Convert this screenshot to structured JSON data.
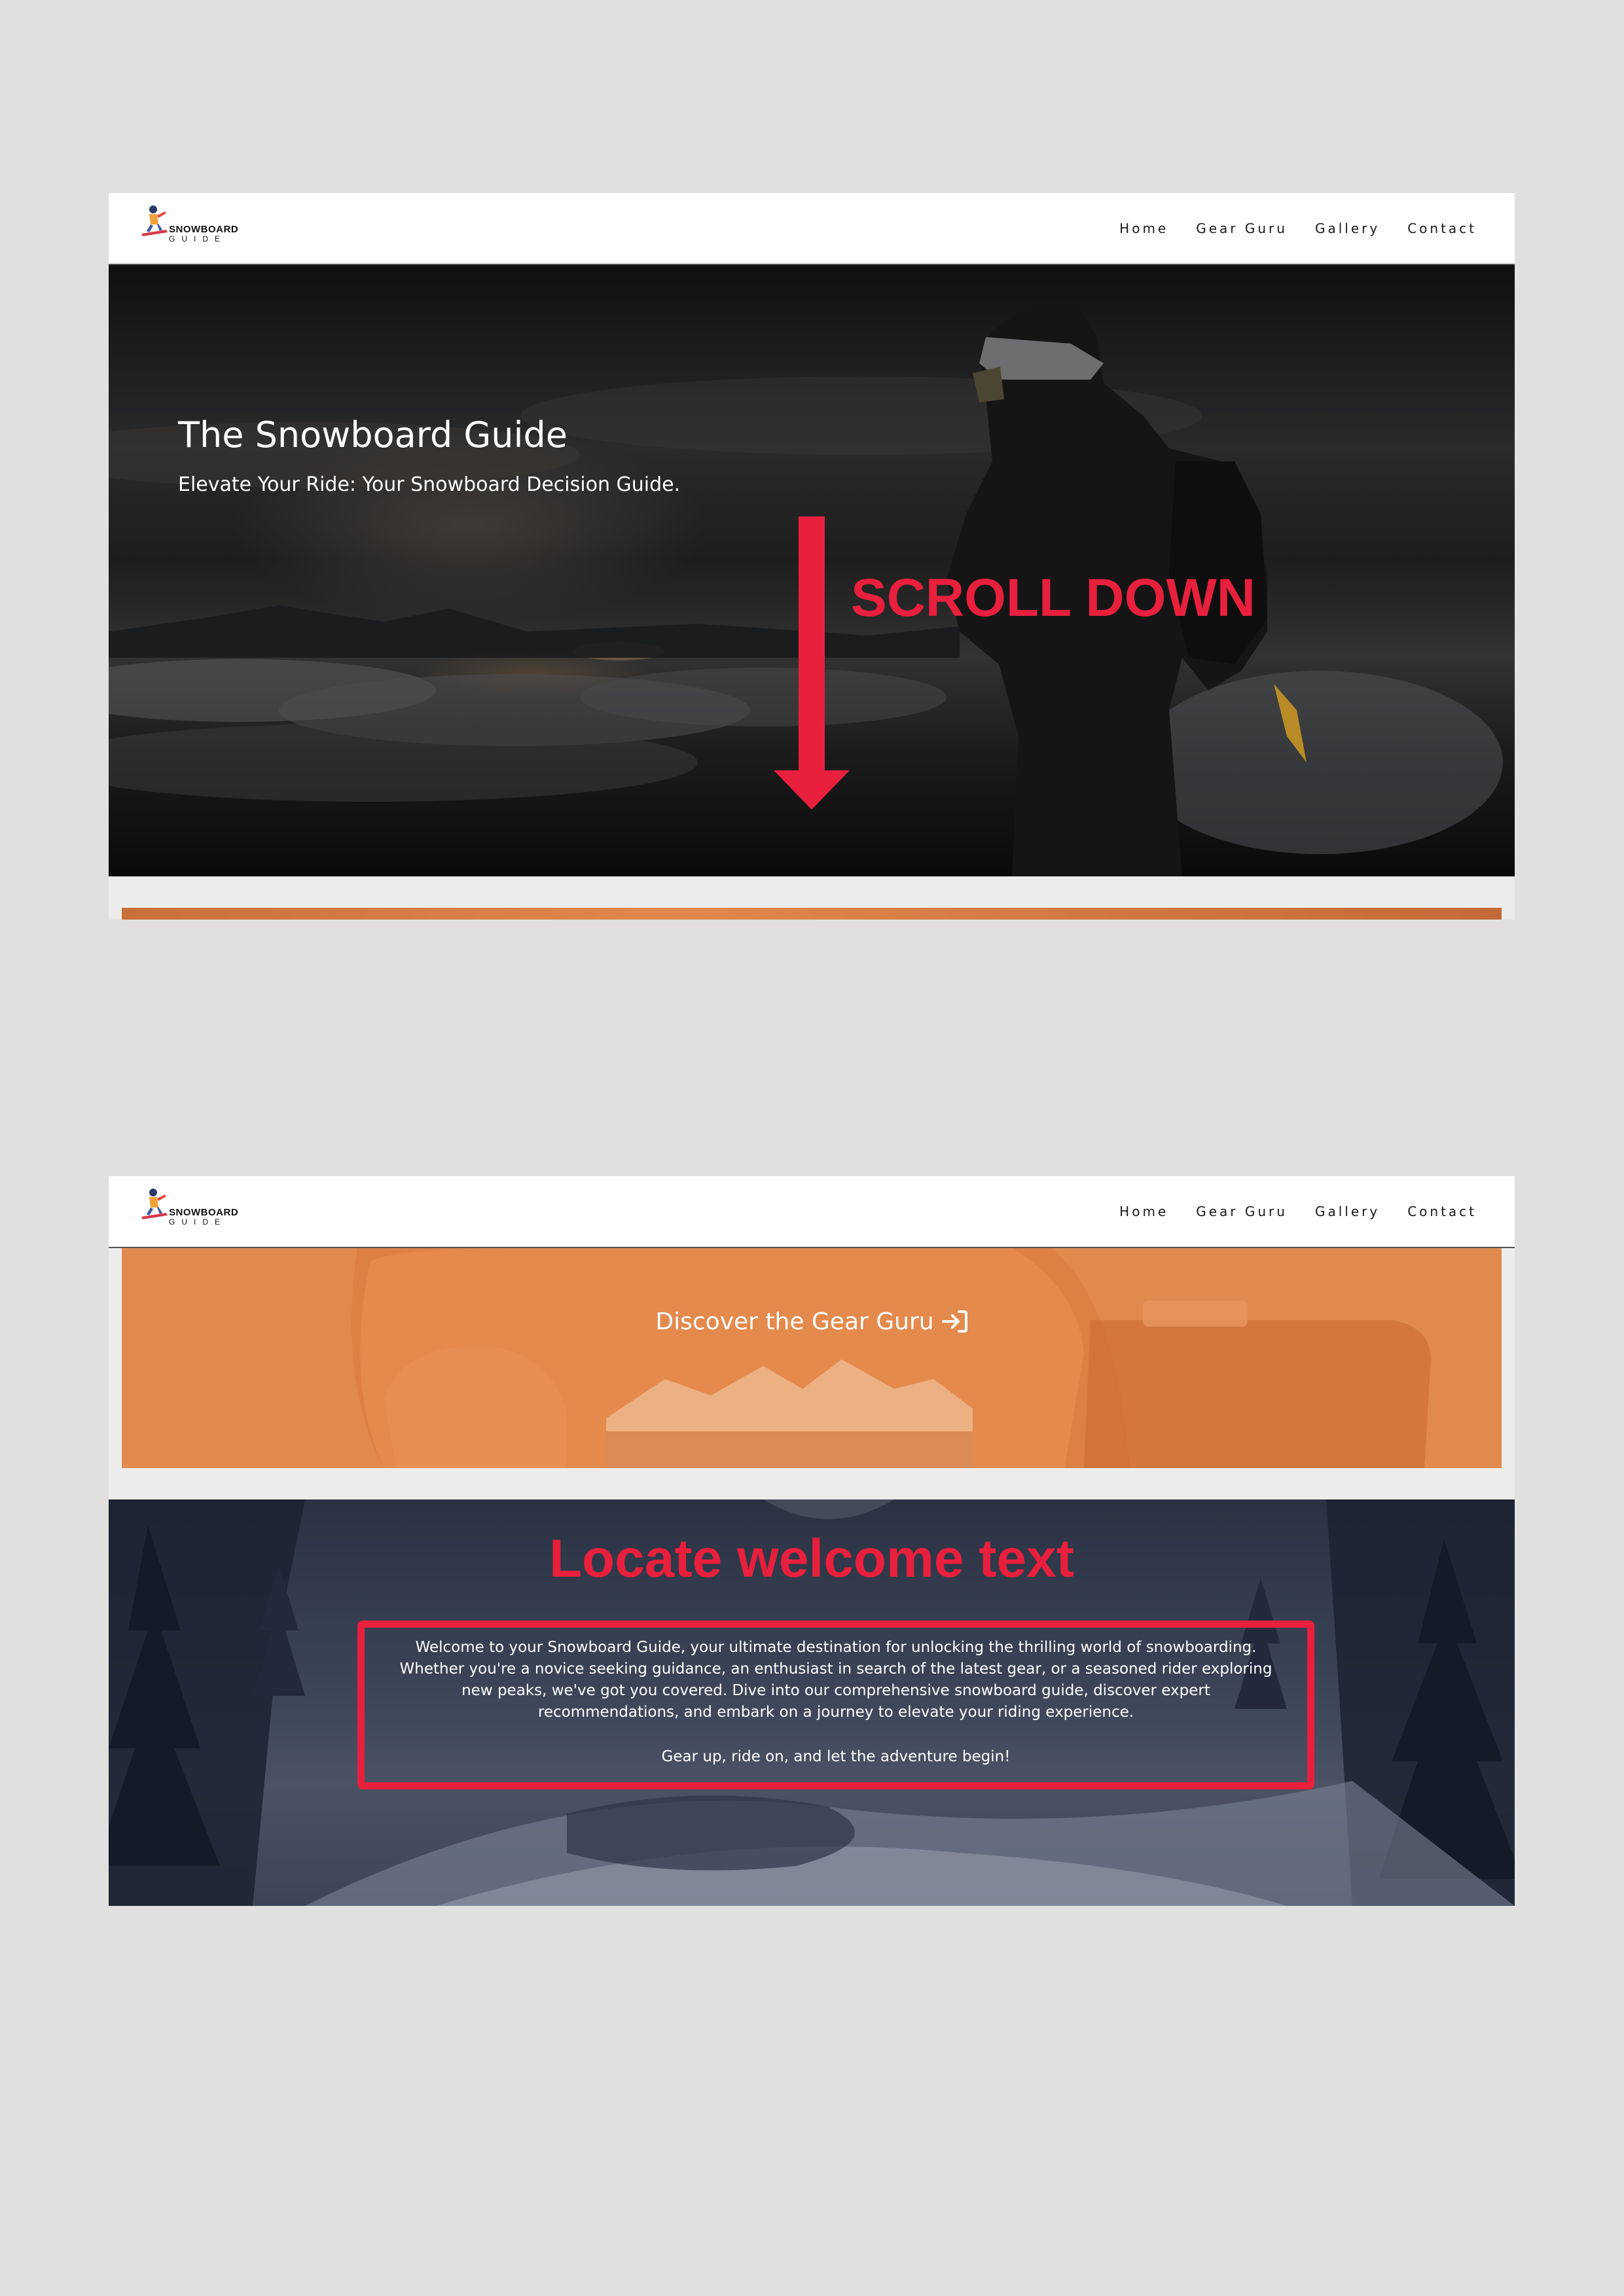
{
  "brand": {
    "logo_word1": "SNOWBOARD",
    "logo_word2": "GUIDE"
  },
  "nav": {
    "items": [
      "Home",
      "Gear Guru",
      "Gallery",
      "Contact"
    ]
  },
  "hero": {
    "title": "The Snowboard Guide",
    "subtitle": "Elevate Your Ride: Your Snowboard Decision Guide."
  },
  "annotations": {
    "scroll": "SCROLL DOWN",
    "locate": "Locate welcome text",
    "color": "#e8203d"
  },
  "gear_banner": {
    "link_text": "Discover the Gear Guru",
    "icon": "arrow-right-to-bracket-icon",
    "color": "#e28a4e"
  },
  "welcome": {
    "paragraph": "Welcome to your Snowboard Guide, your ultimate destination for unlocking the thrilling world of snowboarding. Whether you're a novice seeking guidance, an enthusiast in search of the latest gear, or a seasoned rider exploring new peaks, we've got you covered. Dive into our comprehensive snowboard guide, discover expert recommendations, and embark on a journey to elevate your riding experience.",
    "closing": "Gear up, ride on, and let the adventure begin!"
  }
}
